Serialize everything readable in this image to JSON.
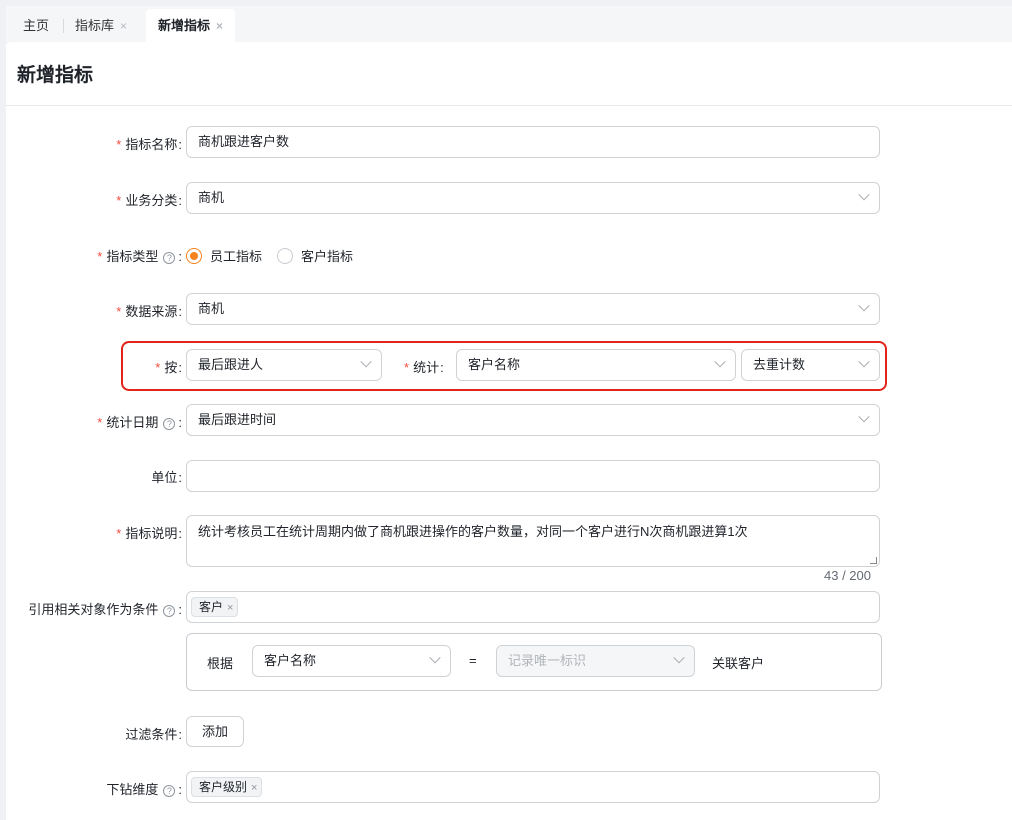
{
  "tabs": [
    {
      "label": "主页"
    },
    {
      "label": "指标库",
      "close": "×"
    },
    {
      "label": "新增指标",
      "close": "×"
    }
  ],
  "page_title": "新增指标",
  "form": {
    "name": {
      "label": "指标名称",
      "value": "商机跟进客户数"
    },
    "category": {
      "label": "业务分类",
      "value": "商机"
    },
    "type": {
      "label": "指标类型",
      "options": [
        "员工指标",
        "客户指标"
      ],
      "selected": "员工指标"
    },
    "source": {
      "label": "数据来源",
      "value": "商机"
    },
    "by": {
      "label": "按",
      "value": "最后跟进人"
    },
    "stat": {
      "label": "统计",
      "value": "客户名称",
      "method": "去重计数"
    },
    "date": {
      "label": "统计日期",
      "value": "最后跟进时间"
    },
    "unit": {
      "label": "单位",
      "value": ""
    },
    "desc": {
      "label": "指标说明",
      "value": "统计考核员工在统计周期内做了商机跟进操作的客户数量，对同一个客户进行N次商机跟进算1次",
      "counter": "43 / 200"
    },
    "ref": {
      "label": "引用相关对象作为条件",
      "tag": "客户"
    },
    "condition": {
      "prefix": "根据",
      "field": "客户名称",
      "op": "=",
      "target_placeholder": "记录唯一标识",
      "suffix": "关联客户"
    },
    "filter": {
      "label": "过滤条件",
      "button": "添加"
    },
    "drill": {
      "label": "下钻维度",
      "tag": "客户级别"
    }
  },
  "icons": {
    "required": "*",
    "help": "?",
    "tag_close": "×"
  },
  "colors": {
    "accent": "#f5811f",
    "required": "#f24b3d",
    "highlight": "#e1251b"
  }
}
